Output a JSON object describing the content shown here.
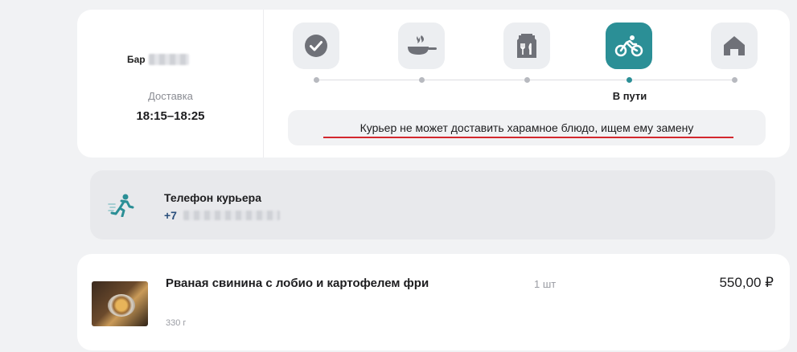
{
  "order": {
    "venue_name": "Бар",
    "delivery_label": "Доставка",
    "delivery_time": "18:15–18:25"
  },
  "status": {
    "steps": [
      {
        "icon": "check-icon"
      },
      {
        "icon": "cooking-pan-icon"
      },
      {
        "icon": "packaging-bag-icon"
      },
      {
        "icon": "bicycle-icon",
        "active": true,
        "label": "В пути"
      },
      {
        "icon": "home-icon"
      }
    ],
    "notice": "Курьер не может доставить харамное блюдо, ищем ему замену",
    "colors": {
      "accent": "#2b8f96",
      "underline": "#d3282e"
    }
  },
  "courier": {
    "icon": "running-courier-icon",
    "title": "Телефон курьера",
    "phone_prefix": "+7"
  },
  "item": {
    "name": "Рваная свинина с лобио и картофелем фри",
    "quantity": "1 шт",
    "price": "550,00 ₽",
    "weight": "330 г"
  }
}
